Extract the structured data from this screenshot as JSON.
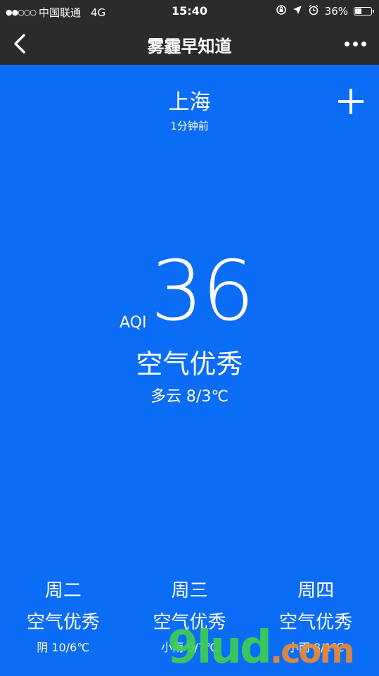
{
  "status_bar": {
    "signal": "●●○○○",
    "carrier": "中国联通",
    "network": "4G",
    "time": "15:40",
    "battery_percent_text": "36%",
    "battery_level": 0.36
  },
  "nav": {
    "title": "雾霾早知道"
  },
  "city": {
    "name": "上海",
    "updated": "1分钟前"
  },
  "current": {
    "aqi_label": "AQI",
    "aqi_value": "36",
    "quality": "空气优秀",
    "weather": "多云 8/3℃"
  },
  "forecast": [
    {
      "day": "周二",
      "quality": "空气优秀",
      "weather": "阴 10/6℃"
    },
    {
      "day": "周三",
      "quality": "空气优秀",
      "weather": "小雨 9/7℃"
    },
    {
      "day": "周四",
      "quality": "空气优秀",
      "weather": "小雨 8/1℃"
    }
  ],
  "watermark": {
    "brand": "9lud",
    "suffix": ".com"
  },
  "colors": {
    "background": "#0b6cf6",
    "bar": "#2b2b2b"
  }
}
